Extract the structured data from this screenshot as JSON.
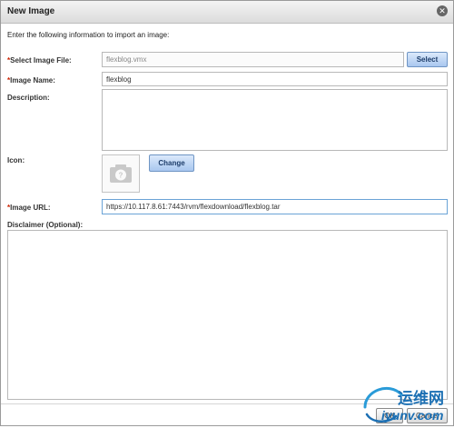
{
  "dialog": {
    "title": "New Image",
    "intro": "Enter the following information to import an image:"
  },
  "form": {
    "image_file": {
      "required_mark": "*",
      "label": "Select Image File:",
      "value": "flexblog.vmx",
      "button": "Select"
    },
    "image_name": {
      "required_mark": "*",
      "label": "Image Name:",
      "value": "flexblog"
    },
    "description": {
      "label": "Description:",
      "value": ""
    },
    "icon": {
      "label": "Icon:",
      "button": "Change"
    },
    "image_url": {
      "required_mark": "*",
      "label": "Image URL:",
      "value": "https://10.117.8.61:7443/rvm/flexdownload/flexblog.tar"
    },
    "disclaimer": {
      "label": "Disclaimer (Optional):",
      "value": ""
    }
  },
  "footer": {
    "ok": "OK",
    "cancel": "Cancel"
  },
  "watermark": {
    "text_cn": "运维网",
    "text_en": "iyunv.com"
  },
  "colors": {
    "required": "#cc2200",
    "button_blue": "#a9c7ef",
    "focus_border": "#6aa3d6"
  }
}
